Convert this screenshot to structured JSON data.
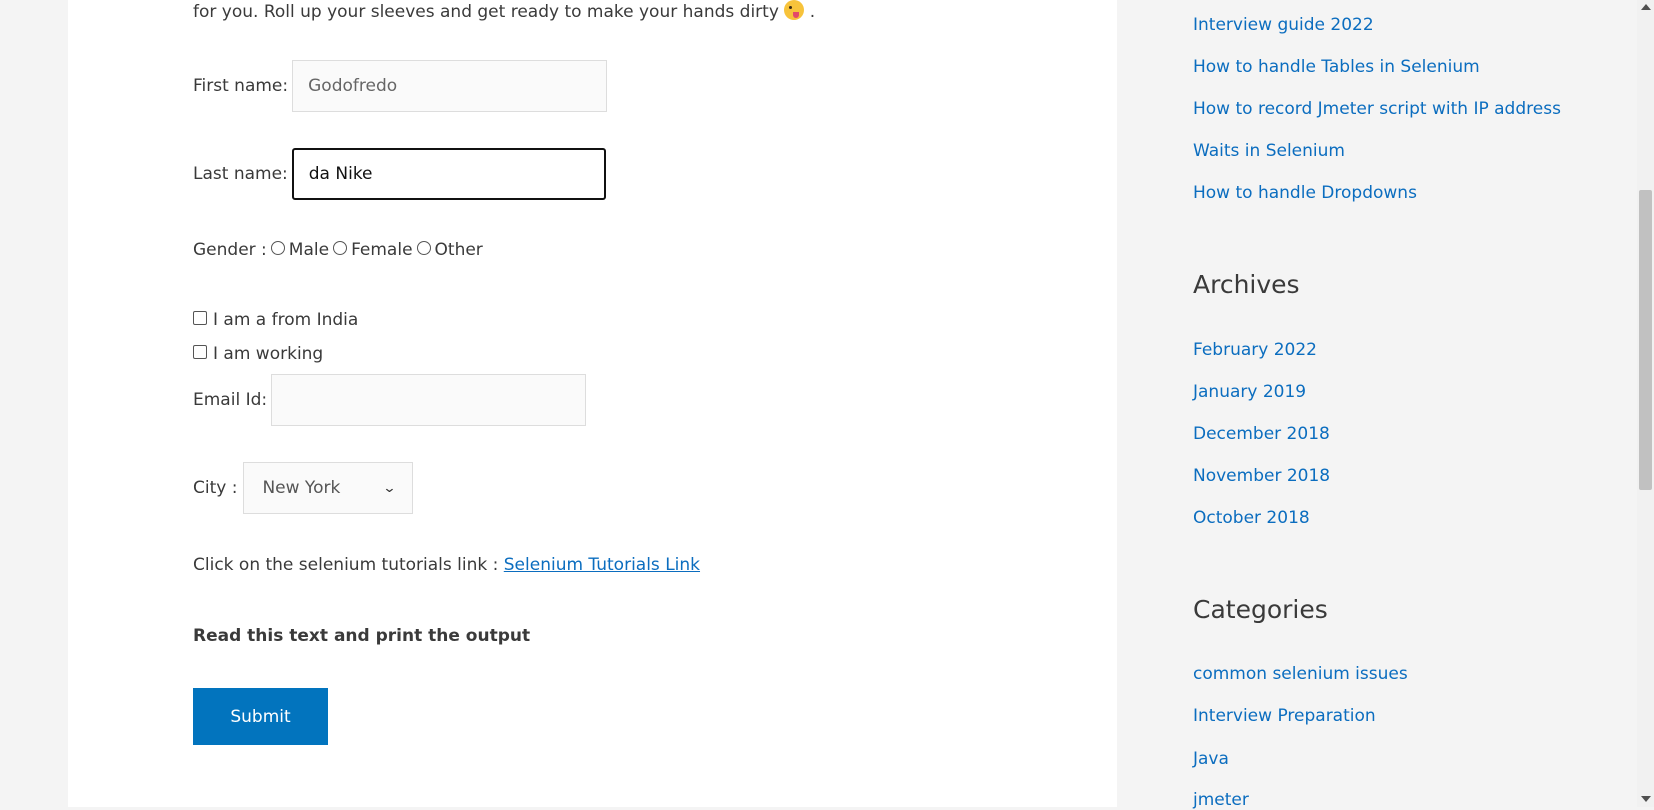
{
  "intro_text": "for you. Roll up your sleeves and get ready to make your hands dirty",
  "intro_suffix": " .",
  "form": {
    "first_name_label": "First name:",
    "first_name_value": "Godofredo",
    "last_name_label": "Last name:",
    "last_name_value": "da Nike",
    "gender_label": "Gender :",
    "gender_options": [
      "Male",
      "Female",
      "Other"
    ],
    "checkbox_india": "I am a from India",
    "checkbox_working": "I am working",
    "email_label": "Email Id:",
    "email_value": "",
    "city_label": "City :",
    "city_selected": "New York",
    "tutorial_text": "Click on the selenium tutorials link :",
    "tutorial_link": "Selenium Tutorials Link",
    "read_text": "Read this text and print the output",
    "submit_label": "Submit"
  },
  "sidebar": {
    "recent_posts": [
      "Interview guide 2022",
      "How to handle Tables in Selenium",
      "How to record Jmeter script with IP address",
      "Waits in Selenium",
      "How to handle Dropdowns"
    ],
    "archives_heading": "Archives",
    "archives": [
      "February 2022",
      "January 2019",
      "December 2018",
      "November 2018",
      "October 2018"
    ],
    "categories_heading": "Categories",
    "categories": [
      "common selenium issues",
      "Interview Preparation",
      "Java",
      "jmeter"
    ]
  },
  "colors": {
    "link": "#0b6dbf",
    "button": "#0274be",
    "background": "#f4f4f4"
  }
}
